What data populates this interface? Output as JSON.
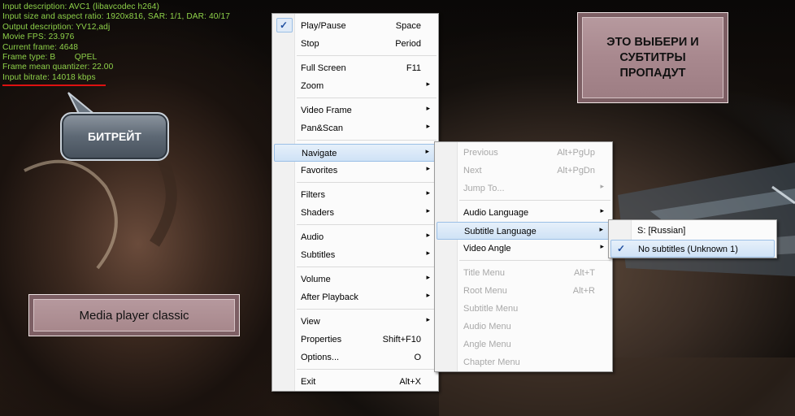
{
  "osd": {
    "lines": [
      "Input description: AVC1 (libavcodec h264)",
      "Input size and aspect ratio: 1920x816, SAR: 1/1, DAR: 40/17",
      "Output description: YV12,adj",
      "Movie FPS: 23.976",
      "Current frame: 4648",
      "Frame type: B        QPEL",
      "Frame mean quantizer: 22.00",
      "Input bitrate: 14018 kbps"
    ]
  },
  "callouts": {
    "bitrate": "БИТРЕЙТ",
    "subs_line1": "ЭТО ВЫБЕРИ И",
    "subs_line2": "СУБТИТРЫ",
    "subs_line3": "ПРОПАДУТ",
    "player": "Media player classic"
  },
  "main_menu": {
    "items": [
      {
        "label": "Play/Pause",
        "key": "Space"
      },
      {
        "label": "Stop",
        "key": "Period"
      },
      {
        "label": "Full Screen",
        "key": "F11"
      },
      {
        "label": "Zoom"
      },
      {
        "label": "Video Frame"
      },
      {
        "label": "Pan&Scan"
      },
      {
        "label": "Navigate"
      },
      {
        "label": "Favorites"
      },
      {
        "label": "Filters"
      },
      {
        "label": "Shaders"
      },
      {
        "label": "Audio"
      },
      {
        "label": "Subtitles"
      },
      {
        "label": "Volume"
      },
      {
        "label": "After Playback"
      },
      {
        "label": "View"
      },
      {
        "label": "Properties",
        "key": "Shift+F10"
      },
      {
        "label": "Options...",
        "key": "O"
      },
      {
        "label": "Exit",
        "key": "Alt+X"
      }
    ]
  },
  "navigate_menu": {
    "items": [
      {
        "label": "Previous",
        "key": "Alt+PgUp"
      },
      {
        "label": "Next",
        "key": "Alt+PgDn"
      },
      {
        "label": "Jump To..."
      },
      {
        "label": "Audio Language"
      },
      {
        "label": "Subtitle Language"
      },
      {
        "label": "Video Angle"
      },
      {
        "label": "Title Menu",
        "key": "Alt+T"
      },
      {
        "label": "Root Menu",
        "key": "Alt+R"
      },
      {
        "label": "Subtitle Menu"
      },
      {
        "label": "Audio Menu"
      },
      {
        "label": "Angle Menu"
      },
      {
        "label": "Chapter Menu"
      }
    ]
  },
  "subtitle_menu": {
    "items": [
      {
        "label": "S: [Russian]"
      },
      {
        "label": "No subtitles (Unknown 1)"
      }
    ]
  },
  "glyphs": {
    "check": "✓",
    "arrow": "▸"
  },
  "colors": {
    "osd_text": "#8fd24a",
    "underline": "#dd1111",
    "highlight": "#cfe2f6"
  }
}
